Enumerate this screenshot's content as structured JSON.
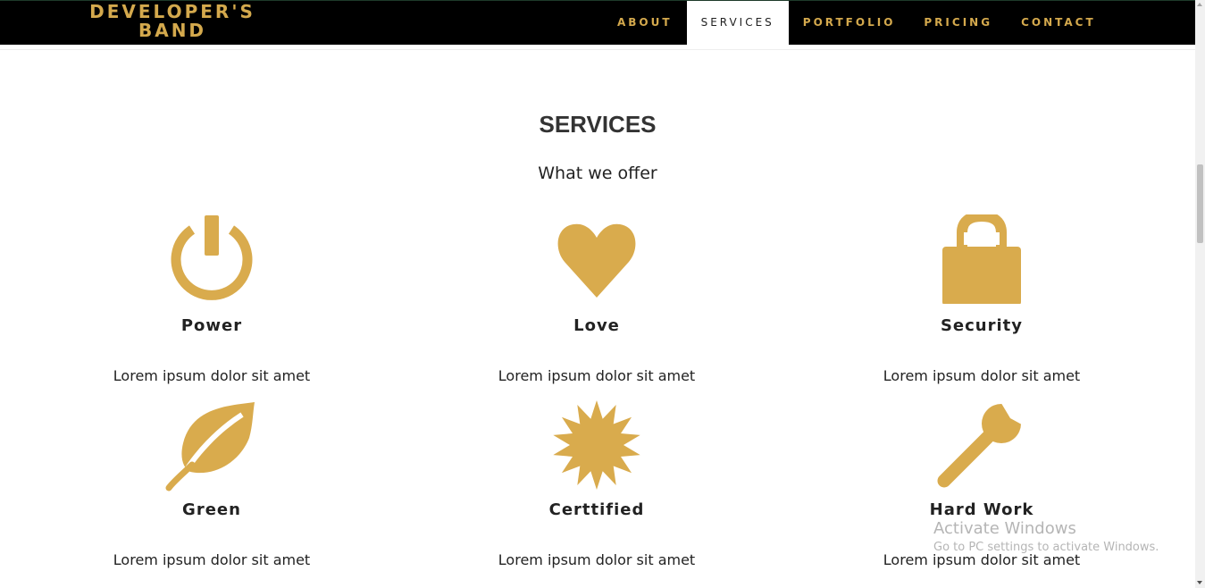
{
  "brand": {
    "line1": "DEVELOPER'S",
    "line2": "BAND"
  },
  "nav": [
    "ABOUT",
    "SERVICES",
    "PORTFOLIO",
    "PRICING",
    "CONTACT"
  ],
  "section": {
    "title": "SERVICES",
    "subtitle": "What we offer"
  },
  "services": [
    {
      "title": "Power",
      "desc": "Lorem ipsum dolor sit amet",
      "icon": "power-icon"
    },
    {
      "title": "Love",
      "desc": "Lorem ipsum dolor sit amet",
      "icon": "heart-icon"
    },
    {
      "title": "Security",
      "desc": "Lorem ipsum dolor sit amet",
      "icon": "lock-icon"
    },
    {
      "title": "Green",
      "desc": "Lorem ipsum dolor sit amet",
      "icon": "leaf-icon"
    },
    {
      "title": "Certtified",
      "desc": "Lorem ipsum dolor sit amet",
      "icon": "certificate-icon"
    },
    {
      "title": "Hard Work",
      "desc": "Lorem ipsum dolor sit amet",
      "icon": "wrench-icon"
    }
  ],
  "watermark": {
    "line1": "Activate Windows",
    "line2": "Go to PC settings to activate Windows."
  },
  "colors": {
    "accent": "#d9ab4d",
    "navbar": "#000000"
  }
}
